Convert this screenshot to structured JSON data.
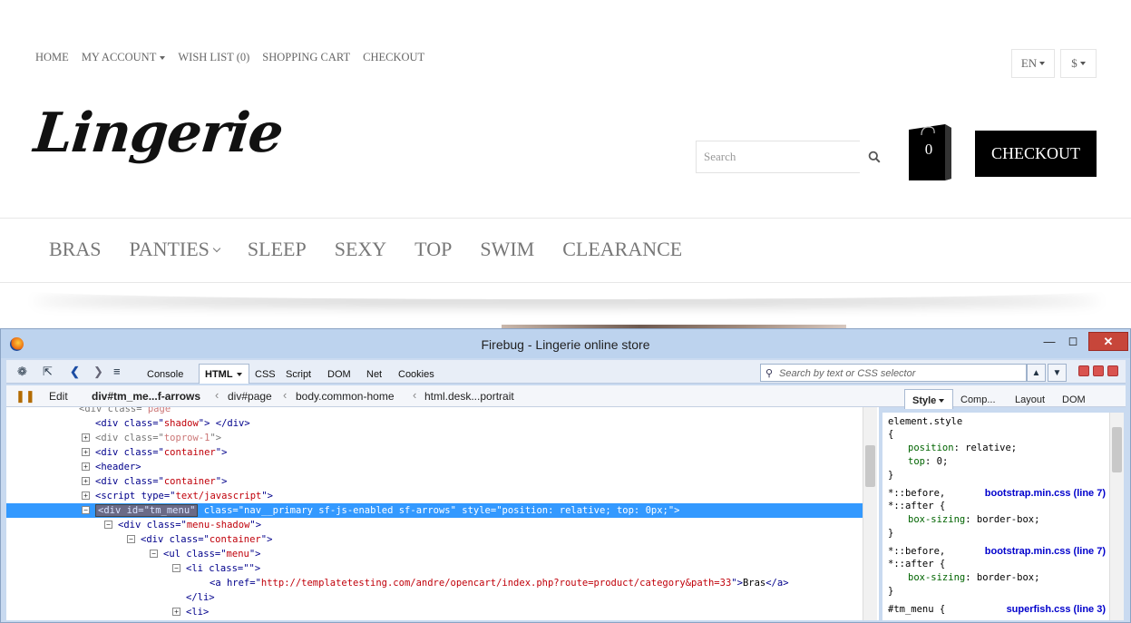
{
  "topnav": {
    "home": "HOME",
    "my_account": "MY ACCOUNT",
    "wish_list": "WISH LIST (0)",
    "shopping_cart": "SHOPPING CART",
    "checkout": "CHECKOUT"
  },
  "language": "EN",
  "currency": "$",
  "logo": "Lingerie",
  "search": {
    "placeholder": "Search"
  },
  "cart": {
    "count": "0"
  },
  "checkout_button": "CHECKOUT",
  "menu": [
    "BRAS",
    "PANTIES",
    "SLEEP",
    "SEXY",
    "TOP",
    "SWIM",
    "CLEARANCE"
  ],
  "firebug": {
    "title": "Firebug - Lingerie online store",
    "tabs": {
      "console": "Console",
      "html": "HTML",
      "css": "CSS",
      "script": "Script",
      "dom": "DOM",
      "net": "Net",
      "cookies": "Cookies"
    },
    "search_placeholder": "Search by text or CSS selector",
    "edit": "Edit",
    "breadcrumbs": [
      "div#tm_me...f-arrows",
      "div#page",
      "body.common-home",
      "html.desk...portrait"
    ],
    "side_tabs": {
      "style": "Style",
      "computed": "Comp...",
      "layout": "Layout",
      "dom": "DOM"
    },
    "html_lines": [
      {
        "pre": "<div class=\"",
        "attr": "page",
        "post": "\""
      },
      {
        "pre": "<div class=\"",
        "attr": "shadow",
        "post": "\"> </div>"
      },
      {
        "pre": "<div class=\"",
        "attr": "toprow-1",
        "post": "\">"
      },
      {
        "pre": "<div class=\"",
        "attr": "container",
        "post": "\">"
      },
      {
        "pre": "<header>",
        "attr": "",
        "post": ""
      },
      {
        "pre": "<div class=\"",
        "attr": "container",
        "post": "\">"
      },
      {
        "pre": "<script type=\"",
        "attr": "text/javascript",
        "post": "\">"
      },
      {
        "tag": "<div id=\"tm_menu\"",
        "pre": " class=\"",
        "attr": "nav__primary sf-js-enabled sf-arrows",
        "mid": "\" style=\"",
        "attr2": "position: relative; top: 0px;",
        "post": "\">"
      },
      {
        "pre": "<div class=\"",
        "attr": "menu-shadow",
        "post": "\">"
      },
      {
        "pre": "<div class=\"",
        "attr": "container",
        "post": "\">"
      },
      {
        "pre": "<ul class=\"",
        "attr": "menu",
        "post": "\">"
      },
      {
        "pre": "<li class=\"",
        "attr": "",
        "post": "\">"
      },
      {
        "pre": "<a href=\"",
        "attr": "http://templatetesting.com/andre/opencart/index.php?route=product/category&path=33",
        "post": "\">",
        "text": "Bras",
        "close": "</a>"
      },
      {
        "pre": "</li>",
        "attr": "",
        "post": ""
      },
      {
        "pre": "<li>",
        "attr": "",
        "post": ""
      }
    ],
    "css_rules": {
      "element_style": "element.style",
      "open": "{",
      "close": "}",
      "p1_name": "position",
      "p1_value": "relative;",
      "p2_name": "top",
      "p2_value": "0;",
      "before": "*::before,",
      "after": "*::after {",
      "box_name": "box-sizing",
      "box_value": "border-box;",
      "src1": "bootstrap.min.css (line 7)",
      "src2": "bootstrap.min.css (line 7)",
      "tm_menu": "#tm_menu {",
      "src3": "superfish.css (line 3)"
    }
  }
}
